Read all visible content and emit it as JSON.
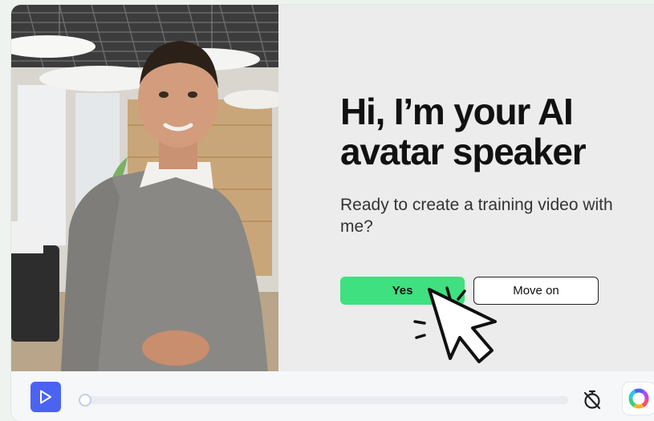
{
  "slide": {
    "headline": "Hi, I’m your AI avatar speaker",
    "subtitle": "Ready to create a training video with me?"
  },
  "buttons": {
    "yes_label": "Yes",
    "move_on_label": "Move on"
  },
  "player": {
    "progress": 0,
    "play_icon": "play-icon",
    "timer_icon": "timer-off-icon",
    "color_wheel_icon": "color-wheel-icon"
  },
  "colors": {
    "accent_green": "#3fe07f",
    "play_blue": "#4b63f2"
  }
}
